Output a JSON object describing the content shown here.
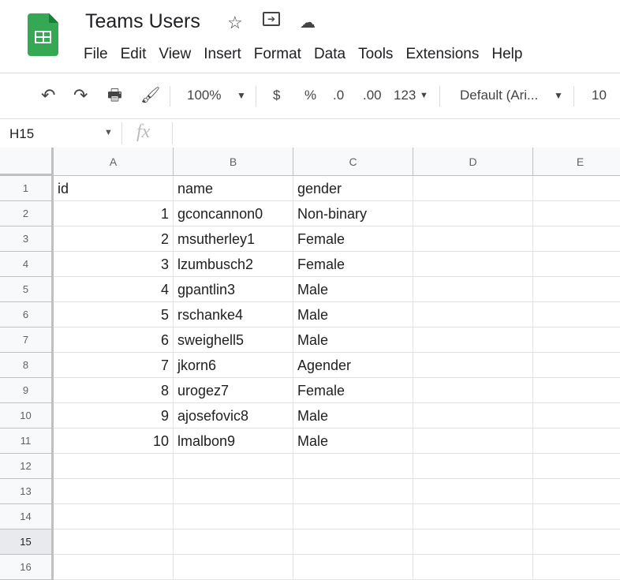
{
  "app": {
    "title": "Teams Users",
    "icons": [
      "star-icon",
      "move-to-folder-icon",
      "cloud-saved-icon"
    ]
  },
  "menu": [
    "File",
    "Edit",
    "View",
    "Insert",
    "Format",
    "Data",
    "Tools",
    "Extensions",
    "Help"
  ],
  "toolbar": {
    "zoom": "100%",
    "currency": "$",
    "percent": "%",
    "decrease_decimal": ".0",
    "increase_decimal": ".00",
    "more_formats": "123",
    "font": "Default (Ari...",
    "font_size": "10"
  },
  "formula_bar": {
    "name_box": "H15",
    "fx": "fx",
    "value": ""
  },
  "columns": [
    "A",
    "B",
    "C",
    "D",
    "E"
  ],
  "rows": [
    [
      "id",
      "name",
      "gender"
    ],
    [
      "1",
      "gconcannon0",
      "Non-binary"
    ],
    [
      "2",
      "msutherley1",
      "Female"
    ],
    [
      "3",
      "lzumbusch2",
      "Female"
    ],
    [
      "4",
      "gpantlin3",
      "Male"
    ],
    [
      "5",
      "rschanke4",
      "Male"
    ],
    [
      "6",
      "sweighell5",
      "Male"
    ],
    [
      "7",
      "jkorn6",
      "Agender"
    ],
    [
      "8",
      "urogez7",
      "Female"
    ],
    [
      "9",
      "ajosefovic8",
      "Male"
    ],
    [
      "10",
      "lmalbon9",
      "Male"
    ],
    [
      "",
      "",
      ""
    ],
    [
      "",
      "",
      ""
    ],
    [
      "",
      "",
      ""
    ],
    [
      "",
      "",
      ""
    ],
    [
      "",
      "",
      ""
    ]
  ],
  "row_numbers": [
    "1",
    "2",
    "3",
    "4",
    "5",
    "6",
    "7",
    "8",
    "9",
    "10",
    "11",
    "12",
    "13",
    "14",
    "15",
    "16"
  ],
  "selected_row": "15"
}
